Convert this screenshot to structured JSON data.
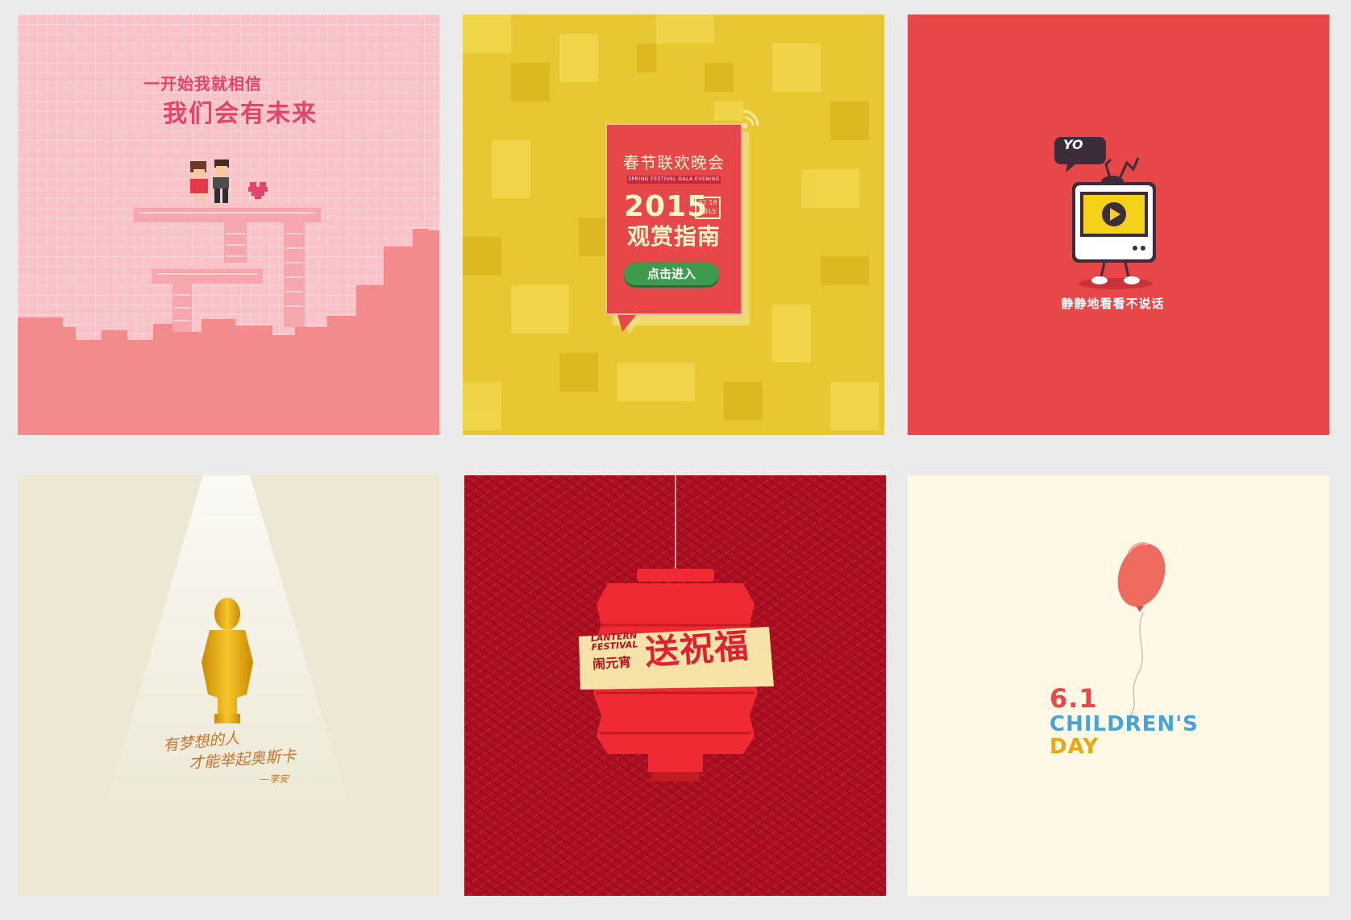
{
  "tiles": [
    {
      "line1": "一开始我就相信",
      "line2": "我们会有未来",
      "colors": {
        "background": "#fbc3c8",
        "skyline": "#f38b8d",
        "text": "#e2456a"
      }
    },
    {
      "title": "春节联欢晚会",
      "ribbon": "SPRING FESTIVAL GALA EVENING",
      "year": "2015",
      "date": "02.18\n2015",
      "guide": "观赏指南",
      "button_label": "点击进入",
      "colors": {
        "background": "#e8c832",
        "card": "#e8474a",
        "button": "#3e9a4c"
      }
    },
    {
      "badge": "YO",
      "caption": "静静地看看不说话",
      "icons": [
        "speech-bubble-icon",
        "tv-icon",
        "play-icon"
      ],
      "colors": {
        "background": "#e8474a",
        "screen": "#f5d21a"
      }
    },
    {
      "line1": "有梦想的人",
      "line2": "才能举起奥斯卡",
      "signature": "—李安",
      "icons": [
        "oscar-statue-icon"
      ],
      "colors": {
        "background": "#ece8d4",
        "statue": "#e8a90f",
        "text": "#c9752b"
      }
    },
    {
      "english": "LANTERN\nFESTIVAL",
      "chinese_small": "闹元宵",
      "chinese_large": "送祝福",
      "icons": [
        "lantern-icon"
      ],
      "colors": {
        "background": "#ad0e20",
        "lantern": "#ef2a32",
        "sign": "#f7e3a7"
      }
    },
    {
      "number": "6.1",
      "title": "CHILDREN'S",
      "subtitle": "DAY",
      "icons": [
        "balloon-icon"
      ],
      "colors": {
        "background": "#fdf9e6",
        "balloon": "#ef6b60",
        "text_palette": [
          "#e8474a",
          "#4aa3d8",
          "#e8a90f",
          "#5bb46a",
          "#d66a9e"
        ]
      }
    }
  ]
}
